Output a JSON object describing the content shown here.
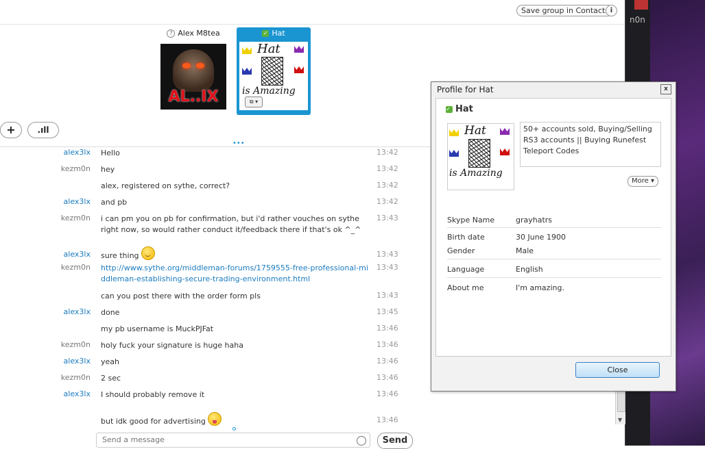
{
  "header": {
    "save_group_label": "Save group in Contacts",
    "info_label": "i",
    "side_label": "n0n"
  },
  "participants": [
    {
      "name": "Alex M8tea",
      "status_icon": "question-icon",
      "avatar_text": "AL..IX"
    },
    {
      "name": "Hat",
      "status_icon": "online-check-icon",
      "avatar_text": "Hat is Amazing"
    }
  ],
  "toolbar": {
    "add_label": "+",
    "signal_label": ".ıll"
  },
  "colors": {
    "accent": "#1a95d2",
    "online": "#5db13a",
    "link": "#1a7bbf"
  },
  "messages": [
    {
      "sender": "alex3lx",
      "text": "Hello",
      "time": "13:42",
      "who": "a"
    },
    {
      "sender": "kezm0n",
      "text": "hey",
      "time": "13:42",
      "who": "k"
    },
    {
      "sender": "",
      "text": "alex, registered on sythe, correct?",
      "time": "13:42",
      "who": "k"
    },
    {
      "sender": "alex3lx",
      "text": "and pb",
      "time": "13:42",
      "who": "a"
    },
    {
      "sender": "kezm0n",
      "text": "i can pm you on pb for confirmation, but i'd rather vouches on sythe right now, so would rather conduct it/feedback there if that's ok ^_^",
      "time": "13:43",
      "who": "k"
    },
    {
      "sender": "alex3lx",
      "text": "sure thing",
      "time": "13:43",
      "who": "a",
      "emoji": "smile"
    },
    {
      "sender": "kezm0n",
      "text": "http://www.sythe.org/middleman-forums/1759555-free-professional-middleman-establishing-secure-trading-environment.html",
      "time": "13:43",
      "who": "k",
      "link": true
    },
    {
      "sender": "",
      "text": "can you post there with the order form pls",
      "time": "13:43",
      "who": "k"
    },
    {
      "sender": "alex3lx",
      "text": "done",
      "time": "13:45",
      "who": "a"
    },
    {
      "sender": "",
      "text": "my pb username is MuckPJFat",
      "time": "13:46",
      "who": "a"
    },
    {
      "sender": "kezm0n",
      "text": "holy fuck your signature is huge haha",
      "time": "13:46",
      "who": "k"
    },
    {
      "sender": "alex3lx",
      "text": "yeah",
      "time": "13:46",
      "who": "a"
    },
    {
      "sender": "kezm0n",
      "text": "2 sec",
      "time": "13:46",
      "who": "k"
    },
    {
      "sender": "alex3lx",
      "text": "I should probably remove it",
      "time": "13:46",
      "who": "a"
    },
    {
      "sender": "",
      "text": "but idk good for advertising",
      "time": "13:46",
      "who": "a",
      "emoji": "tongue"
    }
  ],
  "composer": {
    "placeholder": "Send a message",
    "send_label": "Send"
  },
  "profile": {
    "title": "Profile for Hat",
    "close_x": "x",
    "name": "Hat",
    "mood": "50+ accounts sold, Buying/Selling RS3 accounts || Buying Runefest Teleport Codes",
    "more_label": "More ▾",
    "fields": [
      {
        "key": "Skype Name",
        "value": "grayhatrs"
      },
      {
        "key": "Birth date",
        "value": "30 June 1900"
      },
      {
        "key": "Gender",
        "value": "Male"
      },
      {
        "key": "Language",
        "value": "English"
      },
      {
        "key": "About me",
        "value": "I'm amazing."
      }
    ],
    "close_label": "Close"
  }
}
